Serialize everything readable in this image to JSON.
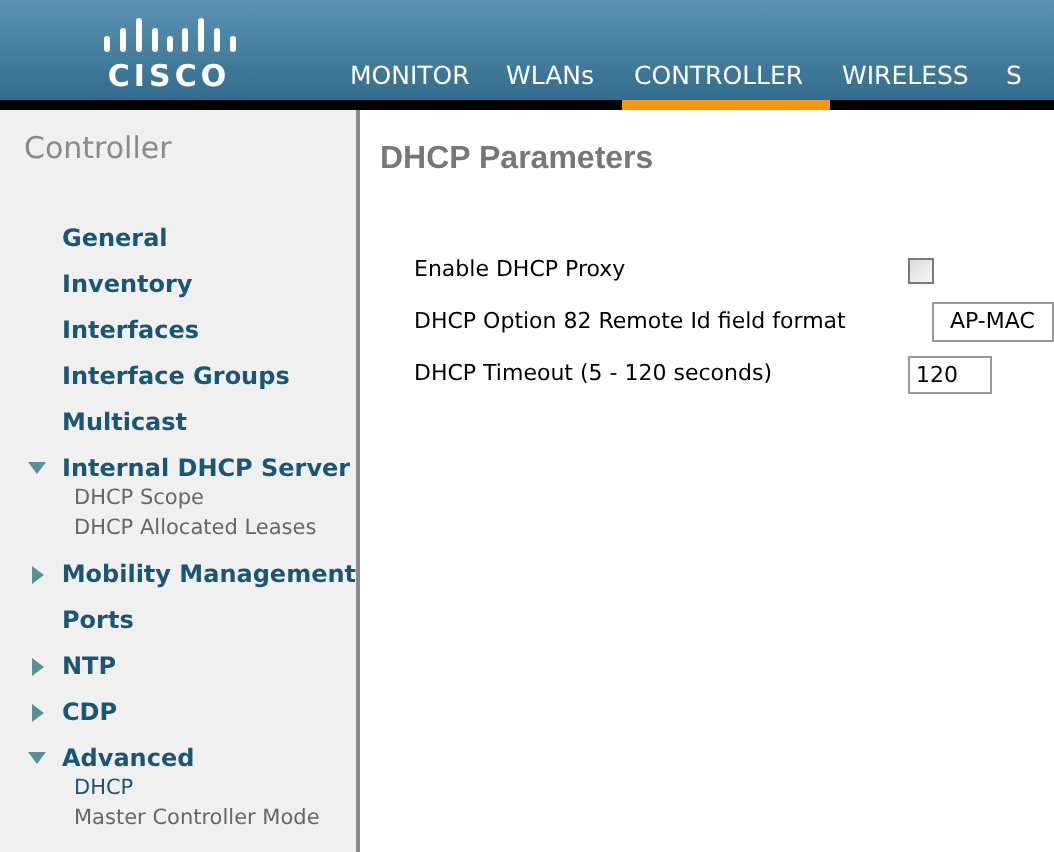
{
  "header": {
    "logo_text": "CISCO",
    "tabs": [
      {
        "label": "MONITOR",
        "selected": false
      },
      {
        "label": "WLANs",
        "selected": false
      },
      {
        "label": "CONTROLLER",
        "selected": true
      },
      {
        "label": "WIRELESS",
        "selected": false
      },
      {
        "label": "S",
        "selected": false
      }
    ]
  },
  "sidebar": {
    "title": "Controller",
    "items": [
      {
        "label": "General",
        "kind": "link"
      },
      {
        "label": "Inventory",
        "kind": "link"
      },
      {
        "label": "Interfaces",
        "kind": "link"
      },
      {
        "label": "Interface Groups",
        "kind": "link"
      },
      {
        "label": "Multicast",
        "kind": "link"
      },
      {
        "label": "Internal DHCP Server",
        "kind": "folder",
        "expanded": true,
        "children": [
          {
            "label": "DHCP Scope",
            "selected": false
          },
          {
            "label": "DHCP Allocated Leases",
            "selected": false
          }
        ]
      },
      {
        "label": "Mobility Management",
        "kind": "folder",
        "expanded": false
      },
      {
        "label": "Ports",
        "kind": "link"
      },
      {
        "label": "NTP",
        "kind": "folder",
        "expanded": false
      },
      {
        "label": "CDP",
        "kind": "folder",
        "expanded": false
      },
      {
        "label": "Advanced",
        "kind": "folder",
        "expanded": true,
        "children": [
          {
            "label": "DHCP",
            "selected": true
          },
          {
            "label": "Master Controller Mode",
            "selected": false
          }
        ]
      }
    ]
  },
  "content": {
    "title": "DHCP Parameters",
    "fields": [
      {
        "label": "Enable DHCP Proxy",
        "kind": "checkbox",
        "checked": false
      },
      {
        "label": "DHCP Option 82 Remote Id field format",
        "kind": "select",
        "value": "AP-MAC"
      },
      {
        "label": "DHCP Timeout (5 - 120 seconds)",
        "kind": "text",
        "value": "120"
      }
    ]
  }
}
